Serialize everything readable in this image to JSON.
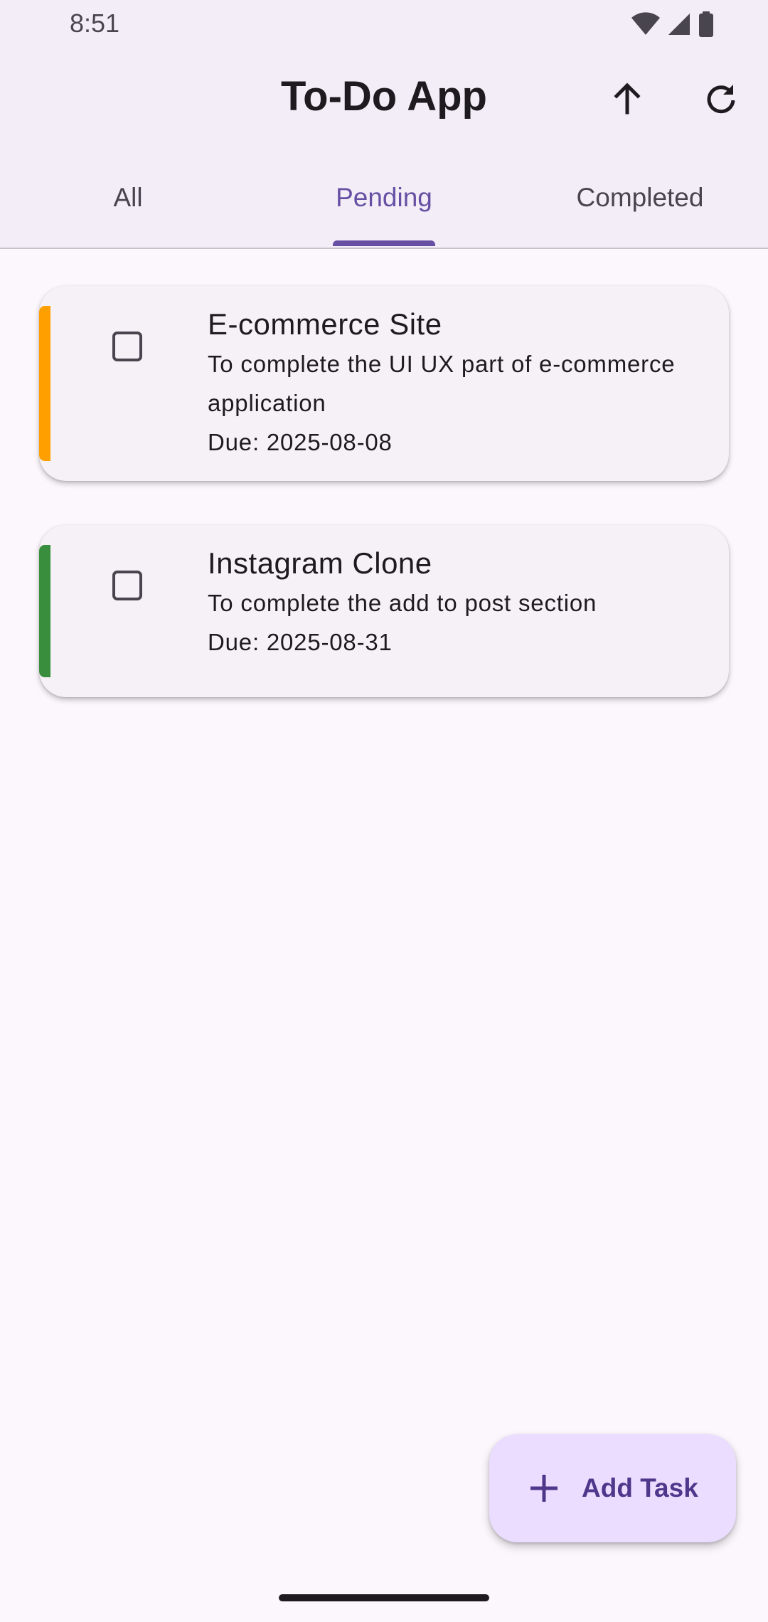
{
  "status_bar": {
    "time": "8:51",
    "icons": [
      "wifi-icon",
      "signal-icon",
      "battery-icon"
    ]
  },
  "app_bar": {
    "title": "To-Do App",
    "actions": [
      {
        "name": "sort-arrow-up-icon"
      },
      {
        "name": "refresh-icon"
      }
    ]
  },
  "tabs": [
    {
      "label": "All",
      "active": false
    },
    {
      "label": "Pending",
      "active": true
    },
    {
      "label": "Completed",
      "active": false
    }
  ],
  "tasks": [
    {
      "title": "E-commerce Site",
      "description": "To complete the UI UX part of e-commerce application",
      "due": "Due: 2025-08-08",
      "checked": false,
      "priority_color": "#ffa000"
    },
    {
      "title": "Instagram Clone",
      "description": "To complete the add to post section",
      "due": "Due: 2025-08-31",
      "checked": false,
      "priority_color": "#388e3c"
    }
  ],
  "fab": {
    "label": "Add Task",
    "icon": "plus-icon"
  },
  "colors": {
    "accent": "#6750a4",
    "fab_background": "#eaddff",
    "top_bar_background": "#f3edf7",
    "page_background": "#fcf7fd"
  }
}
